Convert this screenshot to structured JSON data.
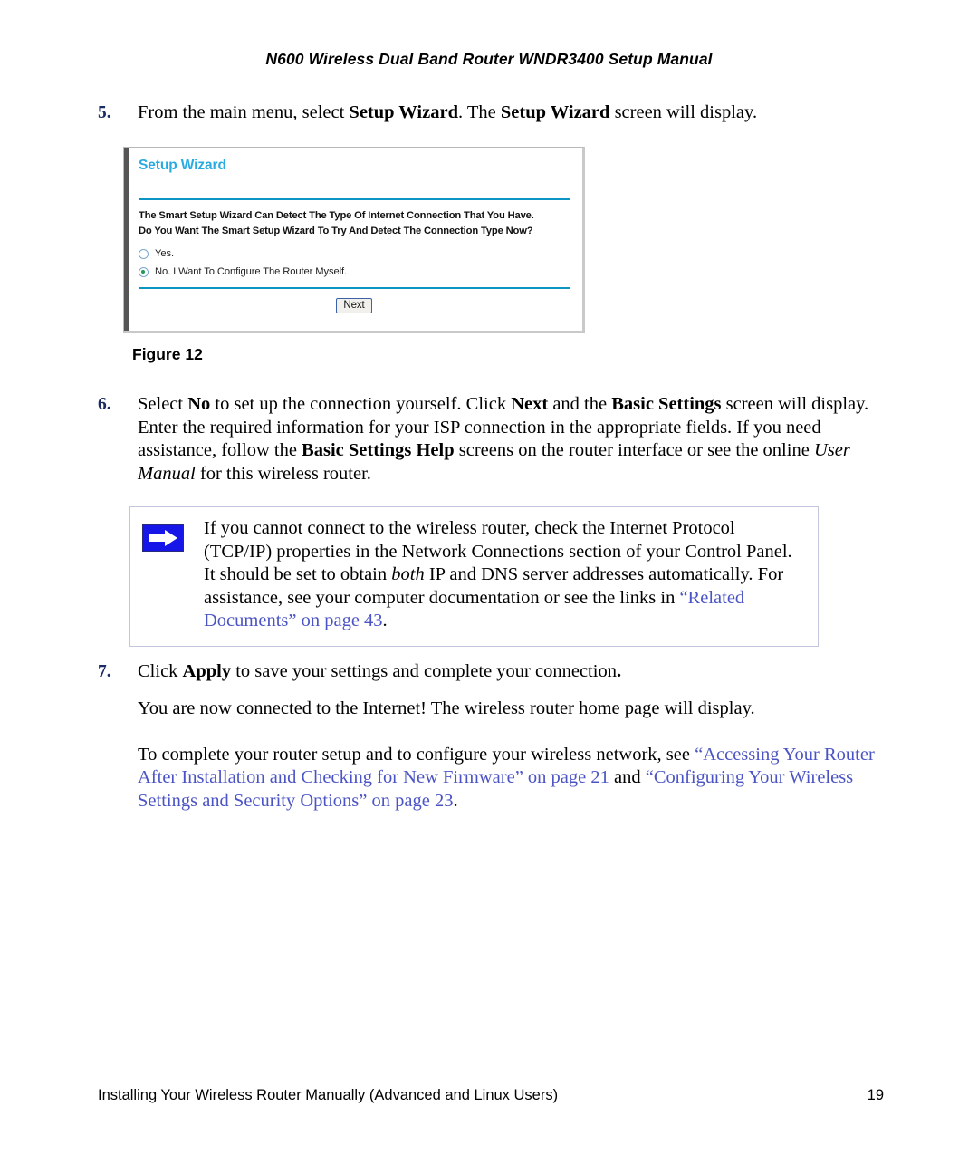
{
  "header": {
    "title": "N600 Wireless Dual Band Router WNDR3400 Setup Manual"
  },
  "steps": {
    "step5": {
      "number": "5.",
      "text_a": "From the main menu, select ",
      "bold_a": "Setup Wizard",
      "text_b": ". The ",
      "bold_b": "Setup Wizard",
      "text_c": " screen will display."
    },
    "step6": {
      "number": "6.",
      "text_a": "Select ",
      "bold_a": "No",
      "text_b": " to set up the connection yourself. Click ",
      "bold_b": "Next",
      "text_c": " and the ",
      "bold_c": "Basic Settings",
      "text_d": " screen will display. Enter the required information for your ISP connection in the appropriate fields. If you need assistance, follow the ",
      "bold_d": "Basic Settings Help",
      "text_e": " screens on the router interface or see the online ",
      "italic_e": "User Manual",
      "text_f": " for this wireless router."
    },
    "step7": {
      "number": "7.",
      "text_a": "Click ",
      "bold_a": "Apply",
      "text_b": " to save your settings and complete your connection",
      "bold_b": "."
    }
  },
  "figure": {
    "caption": "Figure 12",
    "screenshot": {
      "title": "Setup Wizard",
      "body_line1": "The Smart Setup Wizard Can Detect The Type Of Internet Connection That You Have.",
      "body_line2": "Do You Want The Smart Setup Wizard To Try And Detect The Connection Type Now?",
      "options": [
        {
          "label": "Yes.",
          "selected": false
        },
        {
          "label": "No. I Want To Configure The Router Myself.",
          "selected": true
        }
      ],
      "next_button": "Next",
      "accent_color": "#29abe2",
      "rule_color": "#0c95c4"
    }
  },
  "note": {
    "icon": "blue-arrow-icon",
    "text_a": "If you cannot connect to the wireless router, check the Internet Protocol (TCP/IP) properties in the Network Connections section of your Control Panel. It should be set to obtain ",
    "italic_a": "both",
    "text_b": " IP and DNS server addresses automatically. For assistance, see your computer documentation or see the links in ",
    "link_a": "“Related Documents” on page 43",
    "text_c": ".",
    "icon_color": "#1616e8",
    "link_color": "#4b54c4"
  },
  "paragraphs": {
    "connected": "You are now connected to the Internet! The wireless router home page will display.",
    "final": {
      "text_a": "To complete your router setup and to configure your wireless network, see ",
      "link_a": "“Accessing Your Router After Installation and Checking for New Firmware” on page 21",
      "text_b": " and ",
      "link_b": "“Configuring Your Wireless Settings and Security Options” on page 23",
      "text_c": "."
    }
  },
  "footer": {
    "section": "Installing Your Wireless Router Manually (Advanced and Linux Users)",
    "page_number": "19"
  }
}
